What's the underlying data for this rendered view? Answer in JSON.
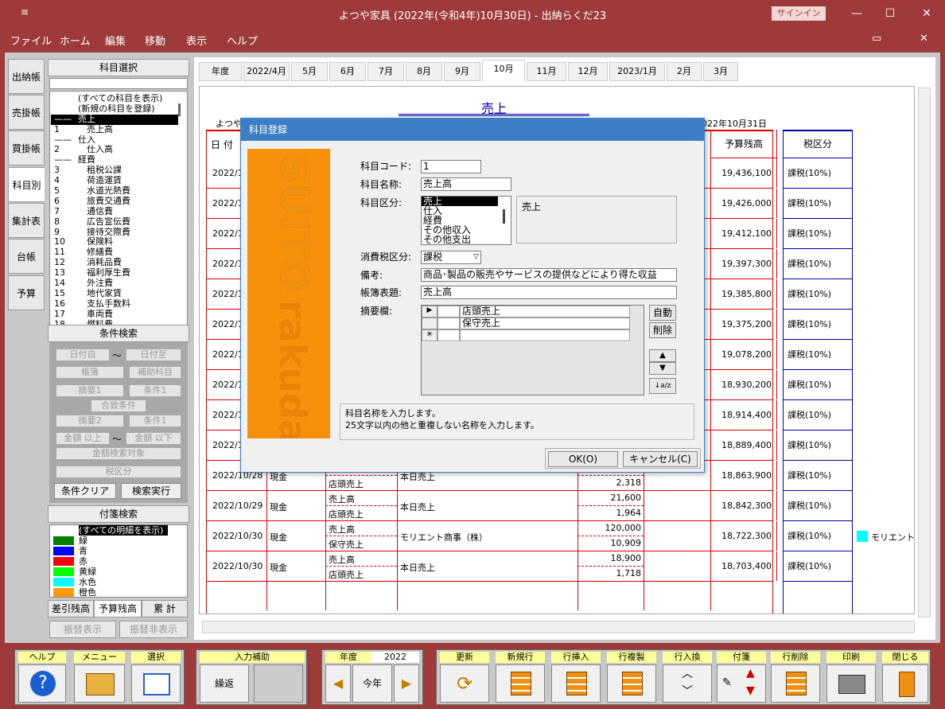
{
  "window": {
    "title": "よつや家具 (2022年(令和4年)10月30日) - 出納らくだ23",
    "signin": "サインイン",
    "minimize": "—",
    "maximize": "☐",
    "close": "✕",
    "menu_icon": "≡"
  },
  "menu": [
    "ファイル",
    "ホーム",
    "編集",
    "移動",
    "表示",
    "ヘルプ"
  ],
  "vtabs": [
    "出納帳",
    "売掛帳",
    "買掛帳",
    "科目別",
    "集計表",
    "台帳",
    "予算"
  ],
  "left": {
    "kamoku_header": "科目選択",
    "kamoku": [
      {
        "num": "",
        "label": "(すべての科目を表示)"
      },
      {
        "num": "",
        "label": "(新規の科目を登録)"
      },
      {
        "num": "——",
        "label": "売上",
        "hl": true
      },
      {
        "num": "1",
        "label": "　売上高"
      },
      {
        "num": "——",
        "label": "仕入"
      },
      {
        "num": "2",
        "label": "　仕入高"
      },
      {
        "num": "——",
        "label": "経費"
      },
      {
        "num": "3",
        "label": "　租税公課"
      },
      {
        "num": "4",
        "label": "　荷造運賃"
      },
      {
        "num": "5",
        "label": "　水道光熱費"
      },
      {
        "num": "6",
        "label": "　旅費交通費"
      },
      {
        "num": "7",
        "label": "　通信費"
      },
      {
        "num": "8",
        "label": "　広告宣伝費"
      },
      {
        "num": "9",
        "label": "　接待交際費"
      },
      {
        "num": "10",
        "label": "　保険料"
      },
      {
        "num": "11",
        "label": "　修繕費"
      },
      {
        "num": "12",
        "label": "　消耗品費"
      },
      {
        "num": "13",
        "label": "　福利厚生費"
      },
      {
        "num": "14",
        "label": "　外注費"
      },
      {
        "num": "15",
        "label": "　地代家賃"
      },
      {
        "num": "16",
        "label": "　支払手数料"
      },
      {
        "num": "17",
        "label": "　車両費"
      },
      {
        "num": "18",
        "label": "　燃料費"
      }
    ],
    "cond_header": "条件検索",
    "cond": {
      "date_from": "日付自",
      "tilde": "〜",
      "date_to": "日付至",
      "book": "帳簿",
      "sub": "補助科目",
      "memo1": "摘要1",
      "c1": "条件1",
      "match": "合致条件",
      "memo2": "摘要2",
      "c2": "条件1",
      "amt_from": "金額 以上",
      "amt_to": "金額 以下",
      "amt_target": "金額検索対象",
      "tax": "税区分",
      "clear": "条件クリア",
      "run": "検索実行"
    },
    "fusen_header": "付箋検索",
    "fusen": [
      {
        "label": "(すべての明細を表示)",
        "color": "",
        "hl": true
      },
      {
        "label": "緑",
        "color": "#008000"
      },
      {
        "label": "青",
        "color": "#0000ff"
      },
      {
        "label": "赤",
        "color": "#ff0000"
      },
      {
        "label": "黄緑",
        "color": "#00ff00"
      },
      {
        "label": "水色",
        "color": "#00ffff"
      },
      {
        "label": "橙色",
        "color": "#ff9900"
      }
    ],
    "btabs": [
      "差引残高",
      "予算残高",
      "累 計"
    ],
    "furikae": [
      "振替表示",
      "振替非表示"
    ]
  },
  "months": [
    "年度",
    "2022/4月",
    "5月",
    "6月",
    "7月",
    "8月",
    "9月",
    "10月",
    "11月",
    "12月",
    "2023/1月",
    "2月",
    "3月"
  ],
  "sheet": {
    "title": "売上",
    "company": "よつや家具",
    "period": "2022年10月31日",
    "col_date": "日 付",
    "col_budget": "予算残高",
    "col_tax": "税区分",
    "top_rows": [
      {
        "date": "2022/1",
        "budget": "19,436,100",
        "tax": "課税(10%)"
      },
      {
        "date": "2022/1",
        "budget": "19,426,000",
        "tax": "課税(10%)"
      },
      {
        "date": "2022/1",
        "budget": "19,412,100",
        "tax": "課税(10%)"
      },
      {
        "date": "2022/1",
        "budget": "19,397,300",
        "tax": "課税(10%)"
      },
      {
        "date": "2022/1",
        "budget": "19,385,800",
        "tax": "課税(10%)"
      },
      {
        "date": "2022/1",
        "budget": "19,375,200",
        "tax": "課税(10%)"
      },
      {
        "date": "2022/1",
        "budget": "19,078,200",
        "tax": "課税(10%)"
      },
      {
        "date": "2022/1",
        "budget": "18,930,200",
        "tax": "課税(10%)"
      },
      {
        "date": "2022/1",
        "budget": "18,914,400",
        "tax": "課税(10%)"
      },
      {
        "date": "2022/1",
        "budget": "18,889,400",
        "tax": "課税(10%)"
      }
    ],
    "rows": [
      {
        "date": "2022/10/28",
        "acct": "現金",
        "s1": "売上高",
        "s2": "店頭売上",
        "memo": "本日売上",
        "a1": "",
        "a2": "2,318",
        "budget": "18,863,900",
        "tax": "課税(10%)"
      },
      {
        "date": "2022/10/29",
        "acct": "現金",
        "s1": "売上高",
        "s2": "店頭売上",
        "memo": "本日売上",
        "a1": "21,600",
        "a2": "1,964",
        "budget": "18,842,300",
        "tax": "課税(10%)"
      },
      {
        "date": "2022/10/30",
        "acct": "現金",
        "s1": "売上高",
        "s2": "保守売上",
        "memo": "モリエント商事（株）",
        "a1": "120,000",
        "a2": "10,909",
        "budget": "18,722,300",
        "tax": "課税(10%)",
        "tag": "モリエント商"
      },
      {
        "date": "2022/10/30",
        "acct": "現金",
        "s1": "売上高",
        "s2": "店頭売上",
        "memo": "本日売上",
        "a1": "18,900",
        "a2": "1,718",
        "budget": "18,703,400",
        "tax": "課税(10%)"
      }
    ],
    "tag_color": "#00ffff"
  },
  "dialog": {
    "title": "科目登録",
    "brand1": "SUITO",
    "brand2": "rakuda",
    "code_label": "科目コード:",
    "code": "1",
    "name_label": "科目名称:",
    "name": "売上高",
    "kubun_label": "科目区分:",
    "kubun": [
      "売上",
      "仕入",
      "経費",
      "その他収入",
      "その他支出"
    ],
    "kubun_sel": "売上",
    "tax_label": "消費税区分:",
    "tax": "課税",
    "note_label": "備考:",
    "note": "商品･製品の販売やサービスの提供などにより得た収益",
    "book_label": "帳簿表題:",
    "book": "売上高",
    "tekiyo_label": "摘要欄:",
    "tekiyo": [
      "店頭売上",
      "保守売上"
    ],
    "auto": "自動",
    "del": "削除",
    "up": "▲",
    "down": "▼",
    "sort": "↓a/z",
    "help1": "科目名称を入力します。",
    "help2": "25文字以内の他と重複しない名称を入力します。",
    "ok": "OK(O)",
    "cancel": "キャンセル(C)"
  },
  "toolbar": {
    "help": "ヘルプ",
    "menu": "メニュー",
    "select": "選択",
    "input_assist": "入力補助",
    "repeat": "繰返",
    "year": "年度",
    "year_val": "2022",
    "this_year": "今年",
    "update": "更新",
    "newrow": "新規行",
    "insert": "行挿入",
    "copy": "行複製",
    "swap": "行入換",
    "tag": "付箋",
    "delete": "行削除",
    "print": "印刷",
    "close": "閉じる"
  }
}
